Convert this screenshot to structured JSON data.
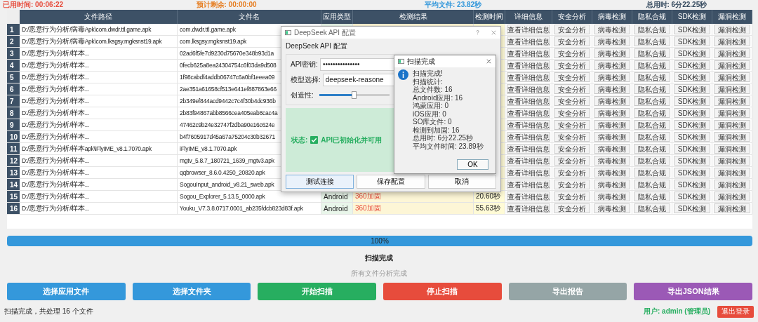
{
  "stats": [
    {
      "label": "已用时间: 00:06:22",
      "color": "#e74c3c"
    },
    {
      "label": "预计剩余: 00:00:00",
      "color": "#e67e22"
    },
    {
      "label": "平均文件: 23.82秒",
      "color": "#3498db"
    },
    {
      "label": "总用时: 6分22.25秒",
      "color": "#34495e"
    }
  ],
  "table": {
    "columns": [
      "文件路径",
      "文件名",
      "应用类型",
      "检测结果",
      "检测时间",
      "详细信息",
      "安全分析",
      "病毒检测",
      "隐私合规",
      "SDK检测",
      "漏洞检测"
    ],
    "rows": [
      {
        "number": "1",
        "path": "D:/恶意行为分析/病毒Apk\\com.dwdr.ttl.game.apk",
        "name": "com.dwdr.ttl.game.apk",
        "actions": [
          "查看详细信息",
          "安全分析",
          "病毒检测",
          "隐私合规",
          "SDK检测",
          "漏洞检测"
        ]
      },
      {
        "number": "2",
        "path": "D:/恶意行为分析/病毒Apk\\com.lksgsy.mgksnst19.apk",
        "name": "com.lksgsy.mgksnst19.apk",
        "actions": [
          "查看详细信息",
          "安全分析",
          "病毒检测",
          "隐私合规",
          "SDK检测",
          "漏洞检测"
        ]
      },
      {
        "number": "3",
        "path": "D:/恶意行为分析/样本...",
        "name": "02ad6f5fe7d9230d75670e348b93d1a",
        "actions": [
          "查看详细信息",
          "安全分析",
          "病毒检测",
          "隐私合规",
          "SDK检测",
          "漏洞检测"
        ]
      },
      {
        "number": "4",
        "path": "D:/恶意行为分析/样本...",
        "name": "0fecb625a8ea24304754c6f03da9d508",
        "actions": [
          "查看详细信息",
          "安全分析",
          "病毒检测",
          "隐私合规",
          "SDK检测",
          "漏洞检测"
        ]
      },
      {
        "number": "5",
        "path": "D:/恶意行为分析/样本...",
        "name": "1f98cabdf4addb06747c6a0bf1eeea09",
        "actions": [
          "查看详细信息",
          "安全分析",
          "病毒检测",
          "隐私合规",
          "SDK检测",
          "漏洞检测"
        ]
      },
      {
        "number": "6",
        "path": "D:/恶意行为分析/样本...",
        "name": "2ae351a61658cf513e641ef887863e66",
        "actions": [
          "查看详细信息",
          "安全分析",
          "病毒检测",
          "隐私合规",
          "SDK检测",
          "漏洞检测"
        ]
      },
      {
        "number": "7",
        "path": "D:/恶意行为分析/样本...",
        "name": "2b349ef844acd9442c7c4f30b4dc936b",
        "actions": [
          "查看详细信息",
          "安全分析",
          "病毒检测",
          "隐私合规",
          "SDK检测",
          "漏洞检测"
        ]
      },
      {
        "number": "8",
        "path": "D:/恶意行为分析/样本...",
        "name": "2b83f94867abb8566cea405eab8cac4a",
        "actions": [
          "查看详细信息",
          "安全分析",
          "病毒检测",
          "隐私合规",
          "SDK检测",
          "漏洞检测"
        ]
      },
      {
        "number": "9",
        "path": "D:/恶意行为分析/样本...",
        "name": "47462c9b24e32747f2dba90e16c624e",
        "actions": [
          "查看详细信息",
          "安全分析",
          "病毒检测",
          "隐私合规",
          "SDK检测",
          "漏洞检测"
        ]
      },
      {
        "number": "10",
        "path": "D:/恶意行为分析/样本...",
        "name": "b4f7605917d45a67a75204c30b32671",
        "actions": [
          "查看详细信息",
          "安全分析",
          "病毒检测",
          "隐私合规",
          "SDK检测",
          "漏洞检测"
        ]
      },
      {
        "number": "11",
        "path": "D:/恶意行为分析/样本apk\\iFlyIME_v8.1.7070.apk",
        "name": "iFlyIME_v8.1.7070.apk",
        "actions": [
          "查看详细信息",
          "安全分析",
          "病毒检测",
          "隐私合规",
          "SDK检测",
          "漏洞检测"
        ]
      },
      {
        "number": "12",
        "path": "D:/恶意行为分析/样本...",
        "name": "mgtv_5.8.7_180721_1639_mgtv3.apk",
        "actions": [
          "查看详细信息",
          "安全分析",
          "病毒检测",
          "隐私合规",
          "SDK检测",
          "漏洞检测"
        ]
      },
      {
        "number": "13",
        "path": "D:/恶意行为分析/样本...",
        "name": "qqbrowser_8.6.0.4250_20820.apk",
        "actions": [
          "查看详细信息",
          "安全分析",
          "病毒检测",
          "隐私合规",
          "SDK检测",
          "漏洞检测"
        ]
      },
      {
        "number": "14",
        "path": "D:/恶意行为分析/样本...",
        "name": "SogouInput_android_v8.21_sweb.apk",
        "actions": [
          "查看详细信息",
          "安全分析",
          "病毒检测",
          "隐私合规",
          "SDK检测",
          "漏洞检测"
        ]
      },
      {
        "number": "15",
        "path": "D:/恶意行为分析/样本...",
        "name": "Sogou_Explorer_5.13.5_0000.apk",
        "app_type": "Android",
        "result": "360加固",
        "time": "20.60秒",
        "actions": [
          "查看详细信息",
          "安全分析",
          "病毒检测",
          "隐私合规",
          "SDK检测",
          "漏洞检测"
        ]
      },
      {
        "number": "16",
        "path": "D:/恶意行为分析/样本...",
        "name": "Youku_V7.3.8.0717.0001_ab235fdcb823d83f.apk",
        "app_type": "Android",
        "result": "360加固",
        "time": "55.63秒",
        "actions": [
          "查看详细信息",
          "安全分析",
          "病毒检测",
          "隐私合规",
          "SDK检测",
          "漏洞检测"
        ]
      }
    ]
  },
  "config_dialog": {
    "title": "DeepSeek API 配置",
    "heading": "DeepSeek API 配置",
    "api_key": {
      "label": "API密钥:",
      "value": "•••••••••••••••"
    },
    "model": {
      "label": "模型选择:",
      "value": "deepseek-reasone"
    },
    "creativity": {
      "label": "创造性:",
      "level": 0.5
    },
    "status": {
      "label": "状态:",
      "checked": true,
      "text": "API已初始化并可用"
    },
    "buttons": [
      "测试连接",
      "保存配置",
      "取消"
    ]
  },
  "message_box": {
    "title": "扫描完成",
    "lines": [
      "扫描完成!",
      "扫描统计:",
      "总文件数: 16",
      "Android应用: 16",
      "鸿蒙应用: 0",
      "iOS应用: 0",
      "SO库文件: 0",
      "检测到加固: 16",
      "总用时: 6分22.25秒",
      "平均文件时间: 23.89秒"
    ],
    "button": "OK"
  },
  "progress": {
    "level": 1,
    "text": "100%"
  },
  "status_title": "扫描完成",
  "status_detail": "所有文件分析完成",
  "actions": [
    {
      "label": "选择应用文件",
      "color": "#3498db"
    },
    {
      "label": "选择文件夹",
      "color": "#3498db"
    },
    {
      "label": "开始扫描",
      "color": "#27ae60"
    },
    {
      "label": "停止扫描",
      "color": "#e74c3c"
    },
    {
      "label": "导出报告",
      "color": "#95a5a6"
    },
    {
      "label": "导出JSON结果",
      "color": "#9b59b6"
    }
  ],
  "status_bar": {
    "message": "扫描完成，共处理 16 个文件",
    "user": "用户: admin (管理员)",
    "logout": "退出登录"
  }
}
